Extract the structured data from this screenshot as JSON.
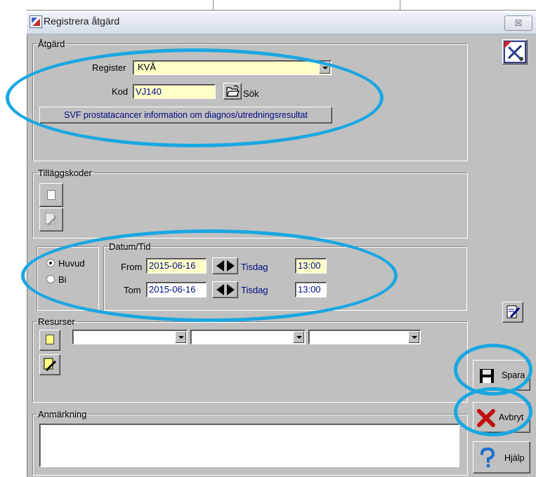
{
  "window": {
    "title": "Registrera åtgärd",
    "close_label": "☒"
  },
  "atgard": {
    "legend": "Åtgärd",
    "register_label": "Register",
    "register_value": "KVÅ",
    "kod_label": "Kod",
    "kod_value": "VJ140",
    "sok_label": "Sök",
    "description_button": "SVF prostatacancer information om diagnos/utredningsresultat"
  },
  "tillaggskoder": {
    "legend": "Tilläggskoder"
  },
  "mode": {
    "options": [
      {
        "label": "Huvud",
        "selected": true
      },
      {
        "label": "Bi",
        "selected": false
      }
    ]
  },
  "datum": {
    "legend": "Datum/Tid",
    "from_label": "From",
    "from_date": "2015-06-16",
    "from_day": "Tisdag",
    "from_time": "13:00",
    "tom_label": "Tom",
    "tom_date": "2015-06-16",
    "tom_day": "Tisdag",
    "tom_time": "13:00"
  },
  "resurser": {
    "legend": "Resurser",
    "combos": [
      "",
      "",
      ""
    ]
  },
  "anmarkning": {
    "legend": "Anmärkning",
    "value": ""
  },
  "actions": {
    "save_label": "Spara",
    "cancel_label": "Avbryt",
    "help_label": "Hjälp"
  },
  "colors": {
    "highlight_ellipse": "#19a7e2",
    "field_background": "#ffffc8",
    "window_background": "#c0c0c0"
  }
}
